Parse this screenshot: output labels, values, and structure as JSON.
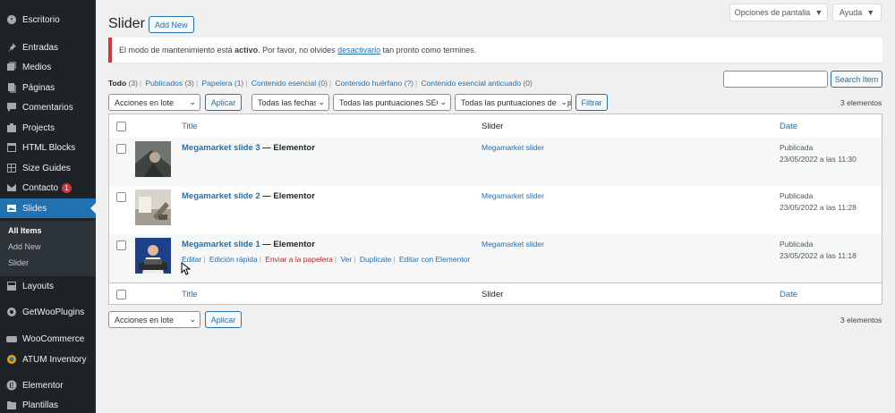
{
  "sidebar": {
    "items": [
      {
        "label": "Escritorio",
        "icon": "dashboard-icon"
      },
      {
        "label": "Entradas",
        "icon": "pin-icon"
      },
      {
        "label": "Medios",
        "icon": "media-icon"
      },
      {
        "label": "Páginas",
        "icon": "pages-icon"
      },
      {
        "label": "Comentarios",
        "icon": "comment-icon"
      },
      {
        "label": "Projects",
        "icon": "portfolio-icon"
      },
      {
        "label": "HTML Blocks",
        "icon": "code-icon"
      },
      {
        "label": "Size Guides",
        "icon": "table-icon"
      },
      {
        "label": "Contacto",
        "icon": "mail-icon",
        "badge": "1"
      },
      {
        "label": "Slides",
        "icon": "slides-icon"
      },
      {
        "label": "Layouts",
        "icon": "layout-icon"
      },
      {
        "label": "GetWooPlugins",
        "icon": "plugin-icon"
      },
      {
        "label": "WooCommerce",
        "icon": "woo-icon"
      },
      {
        "label": "ATUM Inventory",
        "icon": "atum-icon"
      },
      {
        "label": "Elementor",
        "icon": "elementor-icon"
      },
      {
        "label": "Plantillas",
        "icon": "folder-icon"
      }
    ],
    "submenu": [
      "All Items",
      "Add New",
      "Slider"
    ]
  },
  "topbar": {
    "screen_options": "Opciones de pantalla",
    "help": "Ayuda"
  },
  "header": {
    "title": "Slider",
    "add_new": "Add New"
  },
  "notice": {
    "before": "El modo de mantenimiento está ",
    "bold": "activo",
    "middle": ". Por favor, no olvides ",
    "link": "desactivarlo",
    "after": " tan pronto como termines."
  },
  "views": [
    {
      "label": "Todo",
      "count": "(3)"
    },
    {
      "label": "Publicados",
      "count": "(3)"
    },
    {
      "label": "Papelera",
      "count": "(1)"
    },
    {
      "label": "Contenido esencial",
      "count": "(0)"
    },
    {
      "label": "Contenido huérfano",
      "count": "(?)"
    },
    {
      "label": "Contenido esencial anticuado",
      "count": "(0)"
    }
  ],
  "search": {
    "button": "Search Item",
    "value": ""
  },
  "filters": {
    "bulk_action": "Acciones en lote",
    "apply": "Aplicar",
    "dates": "Todas las fechas",
    "seo_scores": "Todas las puntuaciones SEO",
    "readability": "Todas las puntuaciones de legibilidad",
    "filter": "Filtrar",
    "count": "3 elementos"
  },
  "table": {
    "columns": {
      "title": "Title",
      "slider": "Slider",
      "date": "Date"
    },
    "rows": [
      {
        "title": "Megamarket slide 3",
        "state": " — Elementor",
        "slider": "Megamarket slider",
        "status": "Publicada",
        "date": "23/05/2022 a las 11:30"
      },
      {
        "title": "Megamarket slide 2",
        "state": " — Elementor",
        "slider": "Megamarket slider",
        "status": "Publicada",
        "date": "23/05/2022 a las 11:28"
      },
      {
        "title": "Megamarket slide 1",
        "state": " — Elementor",
        "slider": "Megamarket slider",
        "status": "Publicada",
        "date": "23/05/2022 a las 11:18"
      }
    ],
    "row_actions": [
      "Editar",
      "Edición rápida",
      "Enviar a la papelera",
      "Ver",
      "Duplicate",
      "Editar con Elementor"
    ]
  },
  "bottom": {
    "bulk_action": "Acciones en lote",
    "apply": "Aplicar",
    "count": "3 elementos"
  },
  "colors": {
    "accent": "#2271b1",
    "sidebar": "#1d2327",
    "danger": "#d63638"
  }
}
